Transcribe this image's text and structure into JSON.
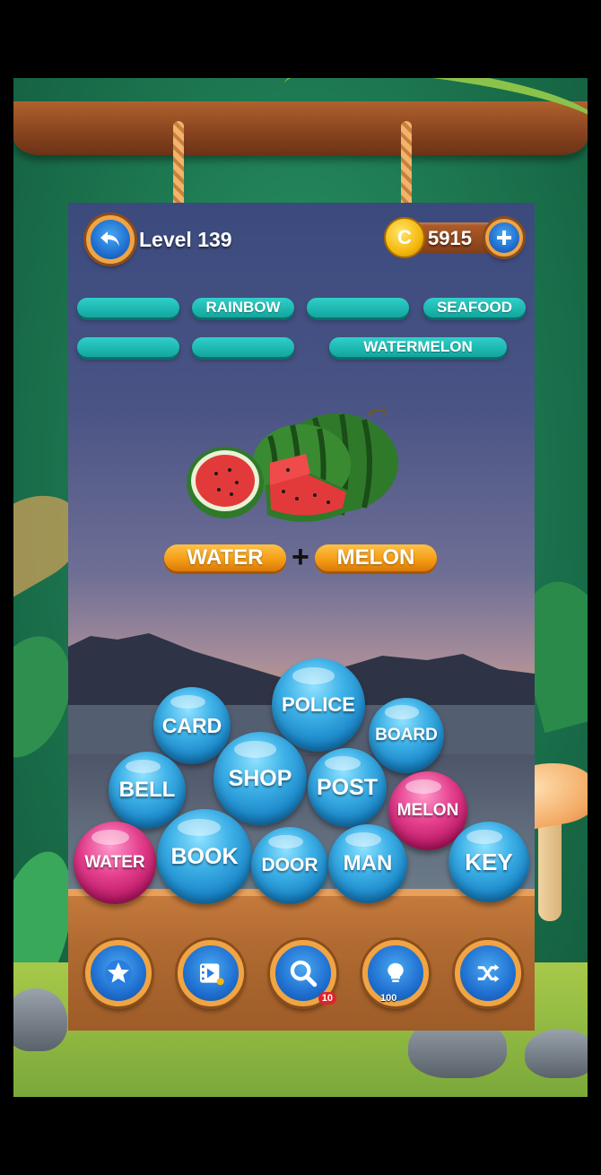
{
  "header": {
    "level_label": "Level 139",
    "coins": "5915",
    "coin_symbol": "C"
  },
  "answers": {
    "row1": [
      "",
      "RAINBOW",
      "",
      "SEAFOOD"
    ],
    "row2": [
      "",
      "",
      "WATERMELON"
    ]
  },
  "clue": {
    "part1": "WATER",
    "operator": "+",
    "part2": "MELON"
  },
  "bubbles": [
    {
      "word": "POLICE",
      "color": "blue"
    },
    {
      "word": "CARD",
      "color": "blue"
    },
    {
      "word": "BOARD",
      "color": "blue"
    },
    {
      "word": "BELL",
      "color": "blue"
    },
    {
      "word": "SHOP",
      "color": "blue"
    },
    {
      "word": "POST",
      "color": "blue"
    },
    {
      "word": "MELON",
      "color": "pink"
    },
    {
      "word": "WATER",
      "color": "pink"
    },
    {
      "word": "BOOK",
      "color": "blue"
    },
    {
      "word": "DOOR",
      "color": "blue"
    },
    {
      "word": "MAN",
      "color": "blue"
    },
    {
      "word": "KEY",
      "color": "blue"
    }
  ],
  "tools": {
    "search_count": "10",
    "hint_cost": "100"
  },
  "colors": {
    "slot_teal": "#1fbab3",
    "bubble_blue": "#1a86c8",
    "bubble_pink": "#e4408e",
    "clue_orange": "#f39a12"
  }
}
